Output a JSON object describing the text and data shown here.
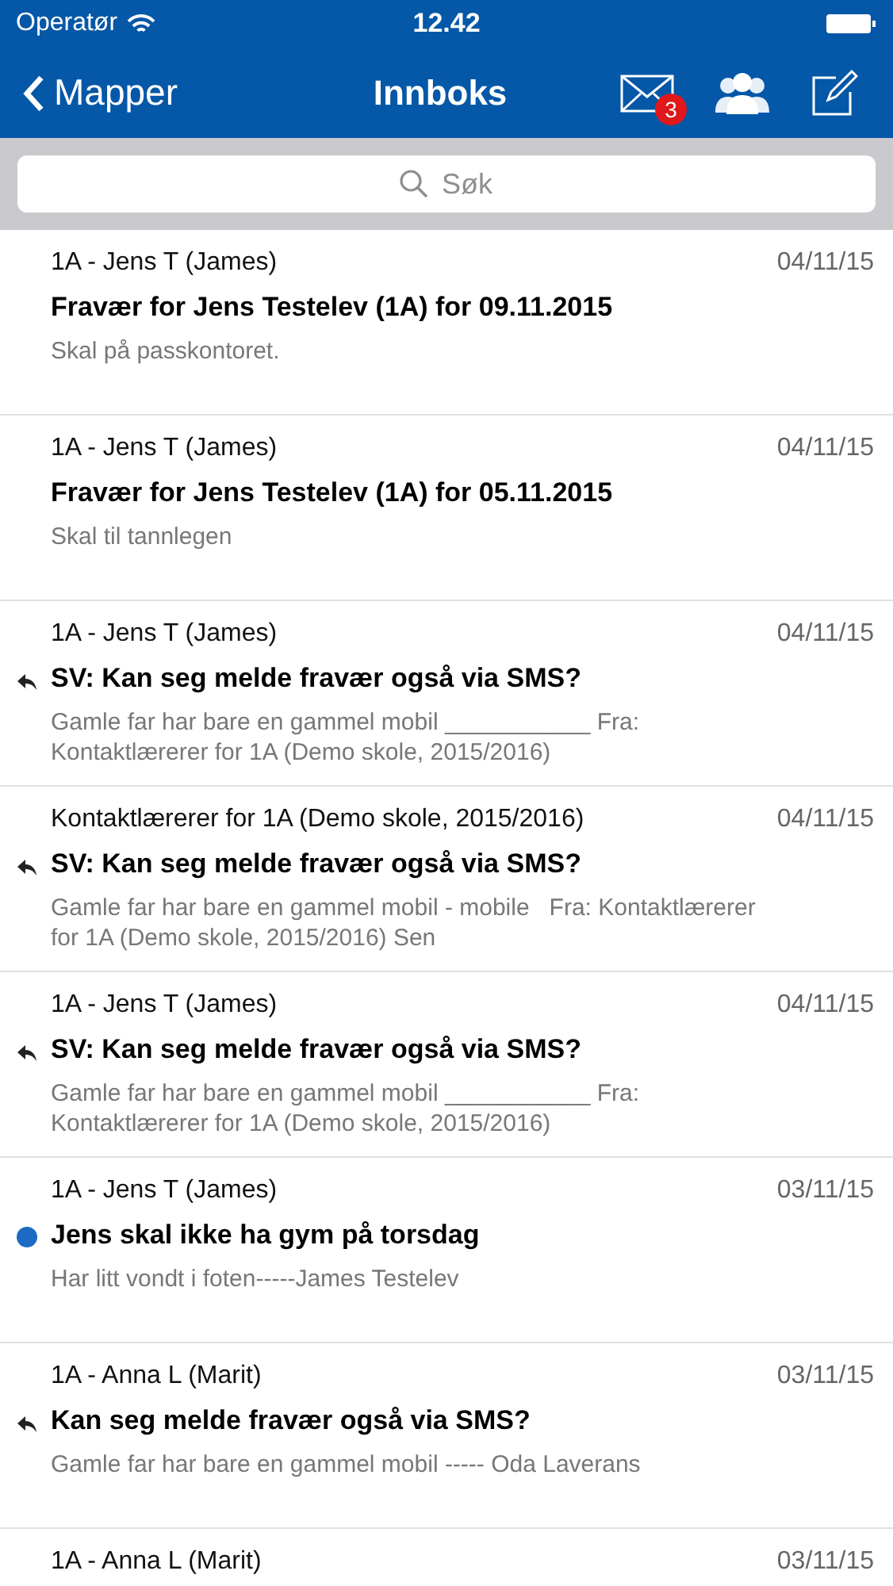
{
  "status_bar": {
    "carrier": "Operatør",
    "time": "12.42"
  },
  "nav": {
    "back": "Mapper",
    "title": "Innboks",
    "mail_badge": "3"
  },
  "search": {
    "placeholder": "Søk"
  },
  "messages": [
    {
      "sender": "1A - Jens T (James)",
      "date": "04/11/15",
      "subject": "Fravær for Jens Testelev (1A) for 09.11.2015",
      "preview": "Skal på passkontoret.",
      "replied": false,
      "unread": false
    },
    {
      "sender": "1A - Jens T (James)",
      "date": "04/11/15",
      "subject": "Fravær for Jens Testelev (1A) for 05.11.2015",
      "preview": "Skal til tannlegen",
      "replied": false,
      "unread": false
    },
    {
      "sender": "1A - Jens T (James)",
      "date": "04/11/15",
      "subject": "SV: Kan seg melde fravær også via SMS?",
      "preview": "Gamle far har bare en gammel mobil ___________ Fra: Kontaktlærerer for 1A (Demo skole, 2015/2016)",
      "replied": true,
      "unread": false
    },
    {
      "sender": "Kontaktlærerer for 1A (Demo skole, 2015/2016)",
      "date": "04/11/15",
      "subject": "SV: Kan seg melde fravær også via SMS?",
      "preview": "Gamle far har bare en gammel mobil - mobile   Fra: Kontaktlærerer for 1A (Demo skole, 2015/2016) Sen",
      "replied": true,
      "unread": false
    },
    {
      "sender": "1A - Jens T (James)",
      "date": "04/11/15",
      "subject": "SV: Kan seg melde fravær også via SMS?",
      "preview": "Gamle far har bare en gammel mobil ___________ Fra: Kontaktlærerer for 1A (Demo skole, 2015/2016)",
      "replied": true,
      "unread": false
    },
    {
      "sender": "1A - Jens T (James)",
      "date": "03/11/15",
      "subject": "Jens skal ikke ha gym på torsdag",
      "preview": "Har litt vondt i foten-----James Testelev",
      "replied": false,
      "unread": true
    },
    {
      "sender": "1A - Anna L (Marit)",
      "date": "03/11/15",
      "subject": "Kan seg melde fravær også via SMS?",
      "preview": "Gamle far har bare en gammel mobil ----- Oda Laverans",
      "replied": true,
      "unread": false
    },
    {
      "sender": "1A - Anna L (Marit)",
      "date": "03/11/15"
    }
  ]
}
